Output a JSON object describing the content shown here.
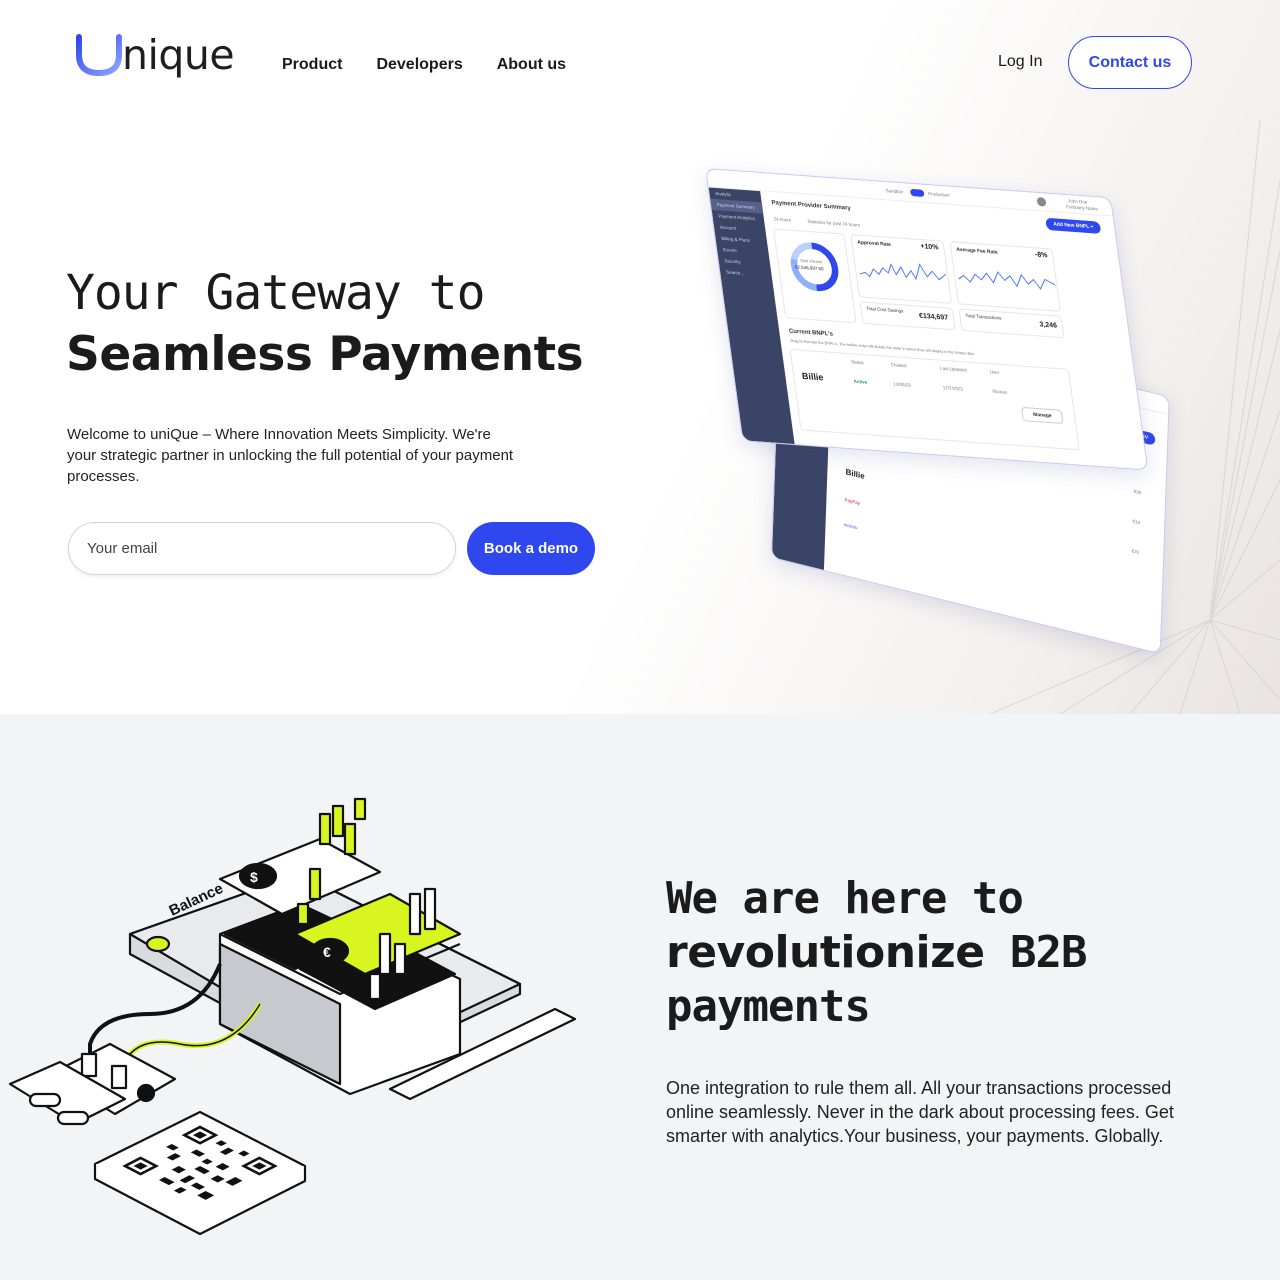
{
  "brand": {
    "logo_text": "nique",
    "accent": "#2f47ee"
  },
  "nav": {
    "items": [
      "Product",
      "Developers",
      "About us"
    ]
  },
  "header": {
    "login_label": "Log In",
    "contact_label": "Contact us"
  },
  "hero": {
    "title_line1": "Your Gateway to",
    "title_line2": "Seamless Payments",
    "description": "Welcome to uniQue – Where Innovation Meets Simplicity. We're your strategic partner in unlocking the full potential of your payment processes.",
    "email_placeholder": "Your email",
    "demo_button": "Book a demo"
  },
  "dashboard": {
    "title": "Payment Provider Summary",
    "add_button": "Add New BNPL +",
    "period": "24 hours",
    "period_note": "Statistics for past 24 hours",
    "toggle_left": "Sandbox",
    "toggle_right": "Production",
    "user_name": "John Doe",
    "company": "Company Name",
    "total_volume_label": "Total volume",
    "total_volume": "€2,546,997.50",
    "approval_rate_label": "Approval Rate",
    "approval_rate": "+10%",
    "avg_fee_label": "Average Fee Rate",
    "avg_fee": "-8%",
    "cost_savings_label": "Total Cost Savings",
    "cost_savings": "€134,697",
    "transactions_label": "Total Transactions",
    "transactions": "3,246",
    "current_label": "Current BNPL's",
    "current_note": "Drag to Reorder the BNPL's. The bellow order will dictate the order in which they will display in the Unique Box.",
    "col_status": "Status",
    "col_created": "Created",
    "col_updated": "Last Updated",
    "col_user": "User",
    "row_name": "Billie",
    "row_status": "Active",
    "row_created": "12/05/23",
    "row_updated": "12/7/2023",
    "row_user": "Nicolas",
    "manage_label": "Manage",
    "csv_label": "CSV",
    "sidebar": [
      "Analytic",
      "Payment Summary",
      "Payment Analytics",
      "Account",
      "Billing & Plans",
      "Events",
      "Security",
      "Search..."
    ],
    "back_rows": [
      {
        "name": "Billie",
        "v": [
          "€30"
        ]
      },
      {
        "name": "PayPay",
        "v": [
          "€14"
        ]
      },
      {
        "name": "mondu",
        "v": [
          "€20"
        ]
      }
    ]
  },
  "section2": {
    "title_line1": "We are here to",
    "title_bold": "revolutionize",
    "title_rest": " B2B",
    "title_line3": "payments",
    "description": "One integration to rule them all. All your transactions processed online seamlessly. Never in the dark about processing fees. Get smarter with analytics.Your business, your payments. Globally.",
    "illustration_label": "Balance"
  }
}
